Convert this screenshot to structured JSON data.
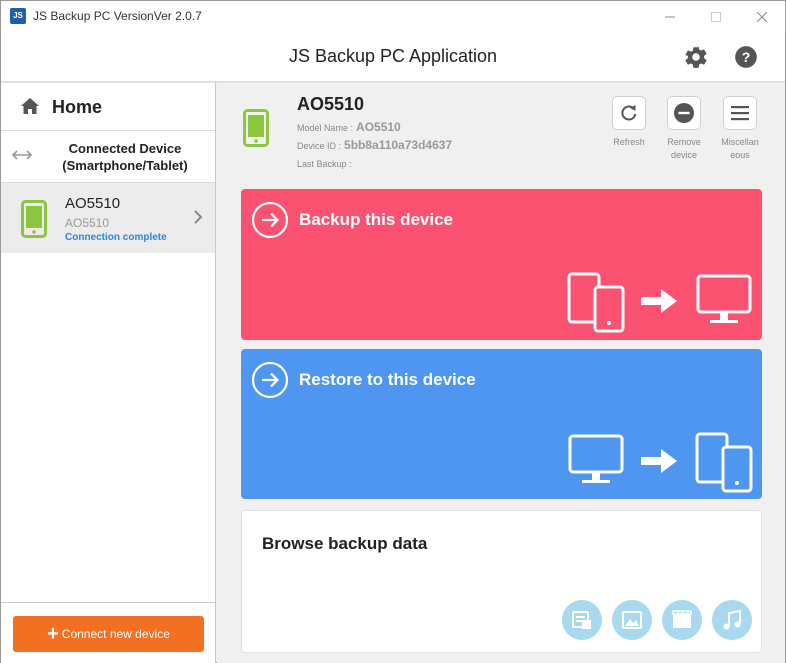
{
  "titlebar": {
    "title": "JS Backup PC VersionVer 2.0.7",
    "icon_text": "JS"
  },
  "header": {
    "title": "JS Backup PC Application"
  },
  "sidebar": {
    "home_label": "Home",
    "connected_title_line1": "Connected Device",
    "connected_title_line2": "(Smartphone/Tablet)",
    "device": {
      "name": "AO5510",
      "model": "AO5510",
      "status": "Connection complete"
    },
    "connect_button": {
      "label": "Connect new device"
    }
  },
  "main": {
    "device_name": "AO5510",
    "model_label": "Model Name :",
    "model_value": "AO5510",
    "id_label": "Device ID :",
    "id_value": "5bb8a110a73d4637",
    "last_backup_label": "Last Backup :",
    "last_backup_value": "",
    "actions": {
      "refresh": "Refresh",
      "remove_line1": "Remove",
      "remove_line2": "device",
      "misc_line1": "Miscellan",
      "misc_line2": "eous"
    },
    "cards": {
      "backup_title": "Backup this device",
      "restore_title": "Restore to this device",
      "browse_title": "Browse backup data"
    }
  },
  "colors": {
    "accent_green": "#8cc63f",
    "backup_card": "#fb5272",
    "restore_card": "#4e96f0",
    "connect_button": "#f36f21",
    "status_blue": "#2f86d8",
    "browse_icon_bg": "#a8d9ef"
  },
  "icons": [
    "settings-gear-icon",
    "help-icon",
    "home-icon",
    "swap-arrows-icon",
    "smartphone-icon",
    "chevron-right-icon",
    "refresh-icon",
    "remove-icon",
    "menu-icon",
    "arrow-circle-icon",
    "contacts-icon",
    "photo-icon",
    "video-icon",
    "music-icon"
  ]
}
